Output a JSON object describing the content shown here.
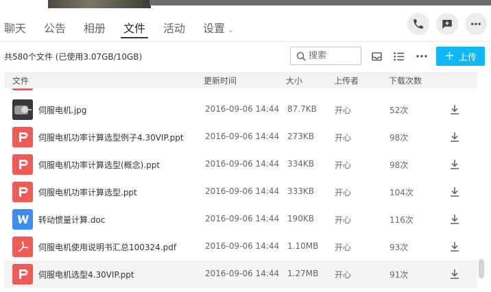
{
  "tabs": [
    {
      "label": "聊天"
    },
    {
      "label": "公告"
    },
    {
      "label": "相册"
    },
    {
      "label": "文件"
    },
    {
      "label": "活动"
    },
    {
      "label": "设置"
    }
  ],
  "active_tab": "文件",
  "summary": "共580个文件 (已使用3.07GB/10GB)",
  "search": {
    "placeholder": "搜索"
  },
  "upload_label": "上传",
  "columns": {
    "name": "文件",
    "time": "更新时间",
    "size": "大小",
    "uploader": "上传者",
    "downloads": "下载次数"
  },
  "files": [
    {
      "name": "伺服电机.jpg",
      "time": "2016-09-06 14:44",
      "size": "87.7KB",
      "uploader": "开心",
      "downloads": "52次",
      "type": "image"
    },
    {
      "name": "伺服电机功率计算选型例子4.30VIP.ppt",
      "time": "2016-09-06 14:44",
      "size": "273KB",
      "uploader": "开心",
      "downloads": "98次",
      "type": "ppt"
    },
    {
      "name": "伺服电机功率计算选型(概念).ppt",
      "time": "2016-09-06 14:44",
      "size": "334KB",
      "uploader": "开心",
      "downloads": "98次",
      "type": "ppt"
    },
    {
      "name": "伺服电机功率计算选型.ppt",
      "time": "2016-09-06 14:44",
      "size": "333KB",
      "uploader": "开心",
      "downloads": "104次",
      "type": "ppt"
    },
    {
      "name": "转动惯量计算.doc",
      "time": "2016-09-06 14:44",
      "size": "190KB",
      "uploader": "开心",
      "downloads": "116次",
      "type": "doc"
    },
    {
      "name": "伺服电机使用说明书汇总100324.pdf",
      "time": "2016-09-06 14:44",
      "size": "1.10MB",
      "uploader": "开心",
      "downloads": "93次",
      "type": "pdf"
    },
    {
      "name": "伺服电机选型4.30VIP.ppt",
      "time": "2016-09-06 14:44",
      "size": "1.27MB",
      "uploader": "开心",
      "downloads": "91次",
      "type": "ppt"
    }
  ],
  "colors": {
    "accent": "#12b7f5",
    "ppt": "#ef5b55",
    "doc": "#3c8ef0",
    "pdf": "#ef5b55"
  },
  "icons": {
    "phone": "phone-icon",
    "message": "message-icon",
    "more": "more-icon",
    "search": "search-icon",
    "download": "download-icon"
  }
}
